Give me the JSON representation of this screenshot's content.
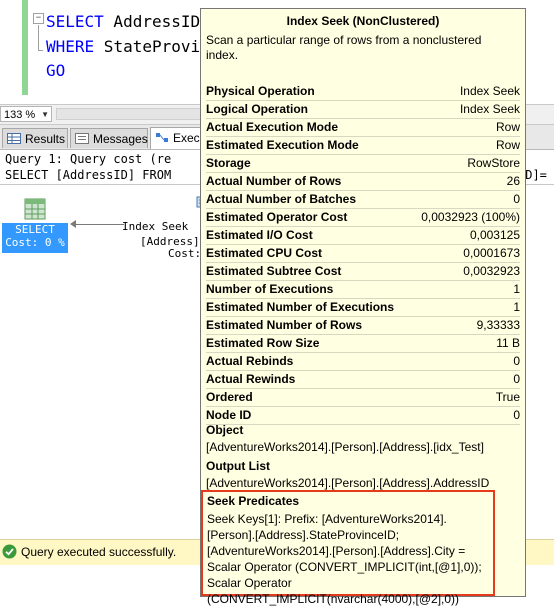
{
  "editor": {
    "lines": [
      {
        "kw": "SELECT",
        "rest": " AddressID"
      },
      {
        "kw": "WHERE",
        "rest": " StateProvi"
      },
      {
        "kw": "GO",
        "rest": ""
      }
    ]
  },
  "zoom": {
    "value": "133 %"
  },
  "tabs": [
    {
      "label": "Results"
    },
    {
      "label": "Messages"
    },
    {
      "label": "Exec"
    }
  ],
  "plan_header": {
    "line1": "Query 1: Query cost (re",
    "line2": "SELECT [AddressID] FROM",
    "line2_right": "ID]="
  },
  "plan": {
    "select_node": {
      "label": "SELECT",
      "cost": "Cost: 0 %"
    },
    "seek_node": {
      "line1": "Index Seek",
      "line2": "[Address]",
      "line3": "Cost:"
    }
  },
  "status": {
    "text": "Query executed successfully."
  },
  "tooltip": {
    "title": "Index Seek (NonClustered)",
    "description": "Scan a particular range of rows from a nonclustered index.",
    "properties": [
      {
        "key": "Physical Operation",
        "value": "Index Seek"
      },
      {
        "key": "Logical Operation",
        "value": "Index Seek"
      },
      {
        "key": "Actual Execution Mode",
        "value": "Row"
      },
      {
        "key": "Estimated Execution Mode",
        "value": "Row"
      },
      {
        "key": "Storage",
        "value": "RowStore"
      },
      {
        "key": "Actual Number of Rows",
        "value": "26"
      },
      {
        "key": "Actual Number of Batches",
        "value": "0"
      },
      {
        "key": "Estimated Operator Cost",
        "value": "0,0032923 (100%)"
      },
      {
        "key": "Estimated I/O Cost",
        "value": "0,003125"
      },
      {
        "key": "Estimated CPU Cost",
        "value": "0,0001673"
      },
      {
        "key": "Estimated Subtree Cost",
        "value": "0,0032923"
      },
      {
        "key": "Number of Executions",
        "value": "1"
      },
      {
        "key": "Estimated Number of Executions",
        "value": "1"
      },
      {
        "key": "Estimated Number of Rows",
        "value": "9,33333"
      },
      {
        "key": "Estimated Row Size",
        "value": "11 B"
      },
      {
        "key": "Actual Rebinds",
        "value": "0"
      },
      {
        "key": "Actual Rewinds",
        "value": "0"
      },
      {
        "key": "Ordered",
        "value": "True"
      },
      {
        "key": "Node ID",
        "value": "0"
      }
    ],
    "object_label": "Object",
    "object_value": "[AdventureWorks2014].[Person].[Address].[idx_Test]",
    "output_label": "Output List",
    "output_value": "[AdventureWorks2014].[Person].[Address].AddressID",
    "seek_label": "Seek Predicates",
    "seek_value": "Seek Keys[1]: Prefix: [AdventureWorks2014].[Person].[Address].StateProvinceID; [AdventureWorks2014].[Person].[Address].City = Scalar Operator (CONVERT_IMPLICIT(int,[@1],0)); Scalar Operator (CONVERT_IMPLICIT(nvarchar(4000),[@2],0))"
  },
  "colors": {
    "highlight_box": "#e53a1c",
    "select_node": "#3399ff",
    "tooltip_bg": "#ffffe1",
    "status_bg": "#fff8c4"
  }
}
